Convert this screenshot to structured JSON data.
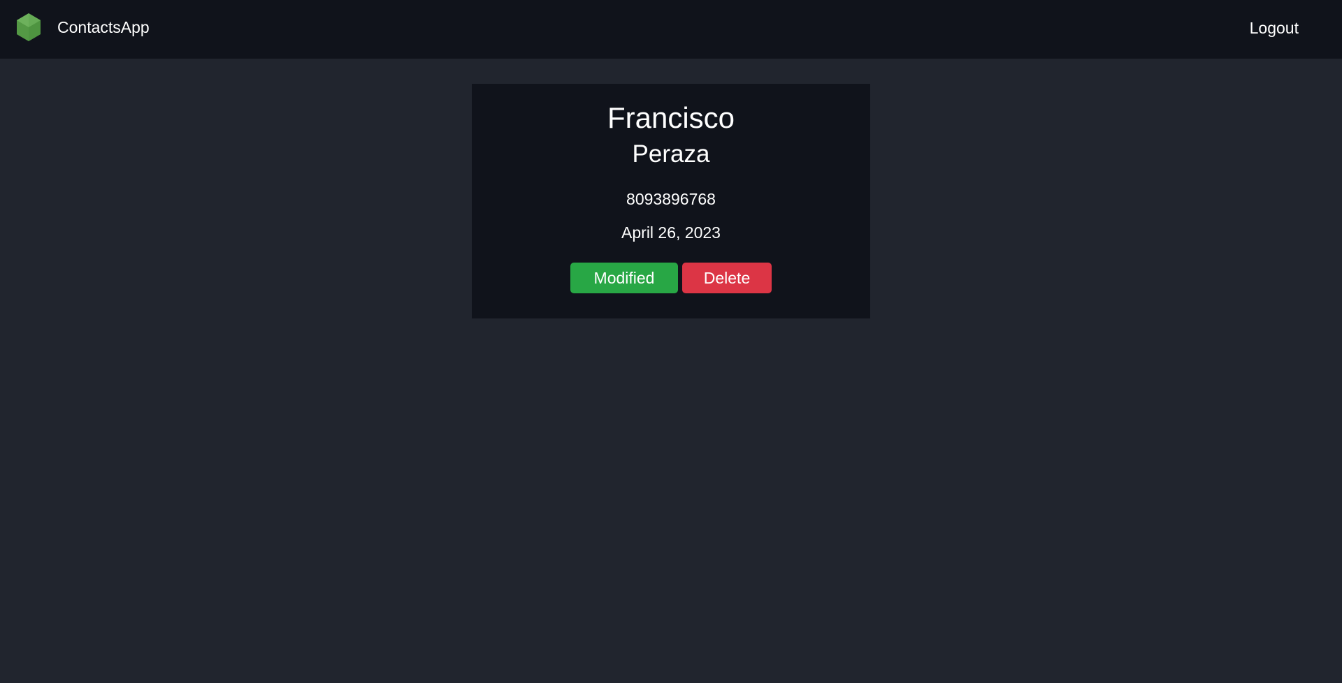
{
  "navbar": {
    "brand": "ContactsApp",
    "logout_label": "Logout",
    "logo_icon": "nodejs-hexagon-icon"
  },
  "contact": {
    "first_name": "Francisco",
    "last_name": "Peraza",
    "phone": "8093896768",
    "date": "April 26, 2023",
    "modify_label": "Modified",
    "delete_label": "Delete"
  },
  "colors": {
    "background": "#21252e",
    "navbar": "#10131b",
    "card": "#10131b",
    "modify_button": "#28a745",
    "delete_button": "#dc3545",
    "logo": "#5fa04e"
  }
}
